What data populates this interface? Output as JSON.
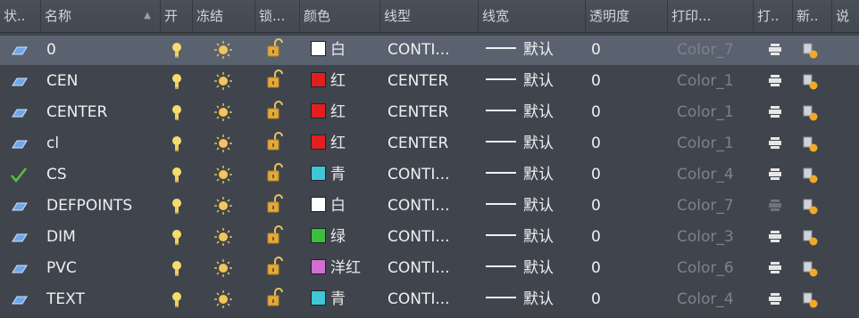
{
  "headers": {
    "status": "状..",
    "name": "名称",
    "on": "开",
    "freeze": "冻结",
    "lock": "锁...",
    "color": "颜色",
    "linetype": "线型",
    "lineweight": "线宽",
    "transparency": "透明度",
    "plotstyle": "打印...",
    "plot": "打..",
    "newvp": "新..",
    "desc": "说"
  },
  "rows": [
    {
      "status": "layer-icon",
      "name": "0",
      "color_hex": "#ffffff",
      "color_name": "白",
      "linetype": "CONTI...",
      "lineweight": "默认",
      "transparency": "0",
      "plotstyle": "Color_7",
      "plot_enabled": true,
      "selected": true
    },
    {
      "status": "layer-icon",
      "name": "CEN",
      "color_hex": "#e02020",
      "color_name": "红",
      "linetype": "CENTER",
      "lineweight": "默认",
      "transparency": "0",
      "plotstyle": "Color_1",
      "plot_enabled": true,
      "selected": false
    },
    {
      "status": "layer-icon",
      "name": "CENTER",
      "color_hex": "#e02020",
      "color_name": "红",
      "linetype": "CENTER",
      "lineweight": "默认",
      "transparency": "0",
      "plotstyle": "Color_1",
      "plot_enabled": true,
      "selected": false
    },
    {
      "status": "layer-icon",
      "name": "cl",
      "color_hex": "#e02020",
      "color_name": "红",
      "linetype": "CENTER",
      "lineweight": "默认",
      "transparency": "0",
      "plotstyle": "Color_1",
      "plot_enabled": true,
      "selected": false
    },
    {
      "status": "current-check-icon",
      "name": "CS",
      "color_hex": "#3fc7d6",
      "color_name": "青",
      "linetype": "CONTI...",
      "lineweight": "默认",
      "transparency": "0",
      "plotstyle": "Color_4",
      "plot_enabled": true,
      "selected": false
    },
    {
      "status": "layer-icon",
      "name": "DEFPOINTS",
      "color_hex": "#ffffff",
      "color_name": "白",
      "linetype": "CONTI...",
      "lineweight": "默认",
      "transparency": "0",
      "plotstyle": "Color_7",
      "plot_enabled": false,
      "selected": false
    },
    {
      "status": "layer-icon",
      "name": "DIM",
      "color_hex": "#3cbf3c",
      "color_name": "绿",
      "linetype": "CONTI...",
      "lineweight": "默认",
      "transparency": "0",
      "plotstyle": "Color_3",
      "plot_enabled": true,
      "selected": false
    },
    {
      "status": "layer-icon",
      "name": "PVC",
      "color_hex": "#d26fd0",
      "color_name": "洋红",
      "linetype": "CONTI...",
      "lineweight": "默认",
      "transparency": "0",
      "plotstyle": "Color_6",
      "plot_enabled": true,
      "selected": false
    },
    {
      "status": "layer-icon",
      "name": "TEXT",
      "color_hex": "#3fc7d6",
      "color_name": "青",
      "linetype": "CONTI...",
      "lineweight": "默认",
      "transparency": "0",
      "plotstyle": "Color_4",
      "plot_enabled": true,
      "selected": false
    }
  ],
  "icons": {
    "on": "lightbulb-icon",
    "freeze": "sun-icon",
    "lock": "unlock-icon",
    "plot": "printer-icon",
    "newvp": "new-viewport-freeze-icon"
  }
}
